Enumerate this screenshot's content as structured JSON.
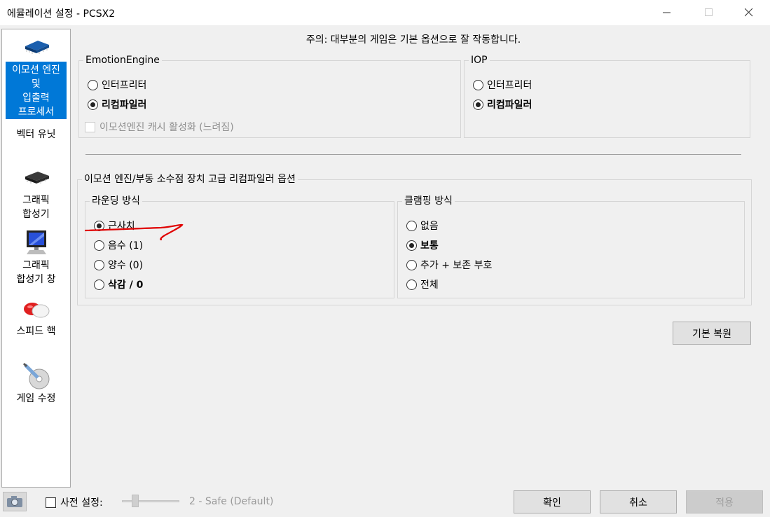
{
  "window": {
    "title": "에뮬레이션 설정 - PCSX2"
  },
  "sidebar": {
    "items": [
      {
        "label_lines": [
          "이모션 엔진",
          "및",
          "입출력",
          "프로세서"
        ],
        "icon": "cpu-chip-icon",
        "selected": true
      },
      {
        "label": "벡터 유닛"
      },
      {
        "label_lines": [
          "그래픽",
          "합성기"
        ],
        "icon": "chip-icon"
      },
      {
        "label_lines": [
          "그래픽",
          "합성기 창"
        ],
        "icon": "monitor-icon"
      },
      {
        "label": "스피드 핵",
        "icon": "pill-icon"
      },
      {
        "label": "게임 수정",
        "icon": "syringe-disc-icon"
      }
    ]
  },
  "note": "주의: 대부분의 게임은 기본 옵션으로 잘 작동합니다.",
  "emotion_engine": {
    "title": "EmotionEngine",
    "options": [
      "인터프리터",
      "리컴파일러"
    ],
    "selected": 1,
    "cache_checkbox": "이모션엔진 캐시 활성화 (느려짐)"
  },
  "iop": {
    "title": "IOP",
    "options": [
      "인터프리터",
      "리컴파일러"
    ],
    "selected": 1
  },
  "advanced": {
    "title": "이모션 엔진/부동 소수점 장치 고급 리컴파일러 옵션",
    "rounding": {
      "title": "라운딩 방식",
      "options": [
        "근사치",
        "음수 (1)",
        "양수 (0)",
        "삭감 / 0"
      ],
      "selected": 0
    },
    "clamping": {
      "title": "클램핑 방식",
      "options": [
        "없음",
        "보통",
        "추가 + 보존 부호",
        "전체"
      ],
      "selected": 1
    }
  },
  "restore_button": "기본 복원",
  "footer": {
    "preset_label": "사전 설정:",
    "preset_value": "2 - Safe (Default)",
    "ok": "확인",
    "cancel": "취소",
    "apply": "적용"
  },
  "annotation_color": "#e00000"
}
